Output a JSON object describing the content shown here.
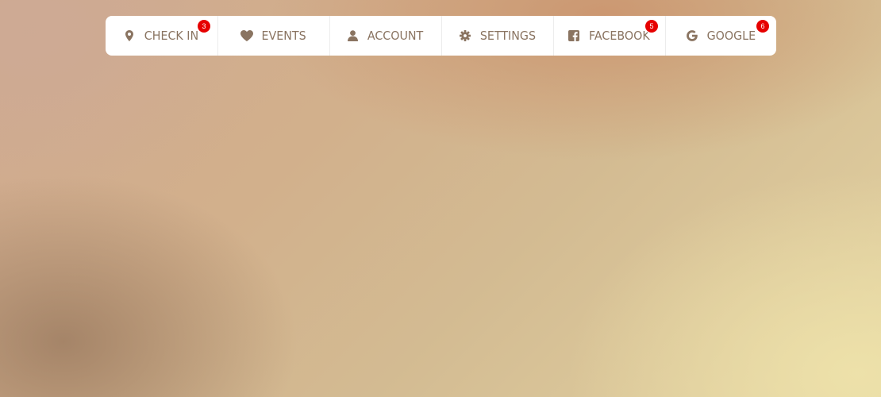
{
  "nav": {
    "items": [
      {
        "label": "CHECK IN",
        "icon": "map-pin-icon",
        "badge": "3"
      },
      {
        "label": "EVENTS",
        "icon": "heart-icon",
        "badge": null
      },
      {
        "label": "ACCOUNT",
        "icon": "user-icon",
        "badge": null
      },
      {
        "label": "SETTINGS",
        "icon": "gear-icon",
        "badge": null
      },
      {
        "label": "FACEBOOK",
        "icon": "facebook-icon",
        "badge": "5"
      },
      {
        "label": "GOOGLE",
        "icon": "google-icon",
        "badge": "6"
      }
    ]
  },
  "colors": {
    "nav_text": "#8a7461",
    "nav_background": "#ffffff",
    "badge_background": "#e60000",
    "badge_text": "#ffffff"
  }
}
